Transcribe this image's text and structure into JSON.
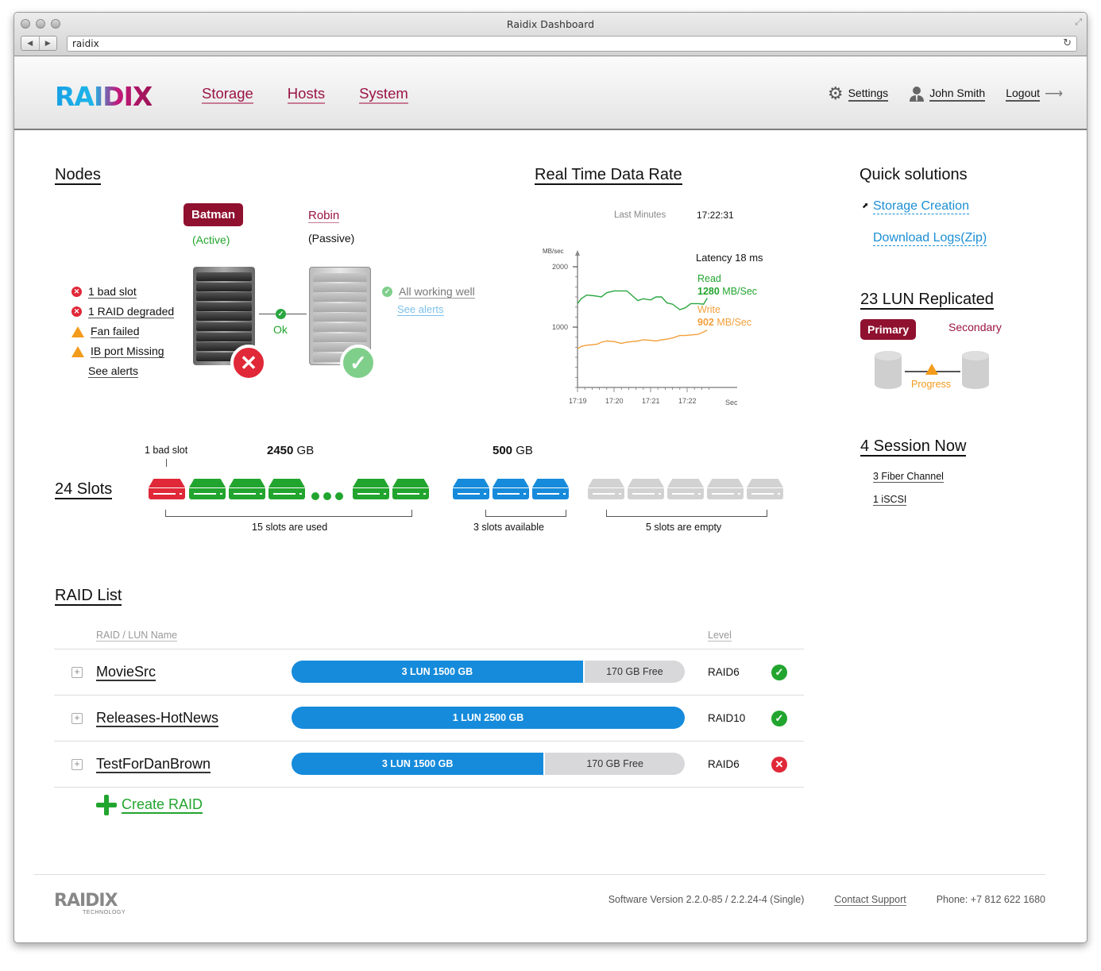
{
  "browser": {
    "window_title": "Raidix Dashboard",
    "url": "raidix",
    "back_icon": "back-arrow-icon",
    "forward_icon": "forward-arrow-icon",
    "reload_icon": "reload-icon"
  },
  "header": {
    "logo": "RAIDIX",
    "nav": [
      "Storage",
      "Hosts",
      "System"
    ],
    "settings_label": "Settings",
    "user_name": "John Smith",
    "logout_label": "Logout"
  },
  "nodes": {
    "title": "Nodes",
    "primary": {
      "name": "Batman",
      "state": "(Active)",
      "status": "error"
    },
    "secondary": {
      "name": "Robin",
      "state": "(Passive)",
      "status": "ok"
    },
    "link_status": "Ok",
    "primary_alerts": [
      {
        "type": "error",
        "text": "1 bad slot"
      },
      {
        "type": "error",
        "text": "1 RAID degraded"
      },
      {
        "type": "warning",
        "text": "Fan failed"
      },
      {
        "type": "warning",
        "text": "IB port Missing"
      }
    ],
    "primary_see_alerts": "See alerts",
    "secondary_alert": "All working well",
    "secondary_see_alerts": "See alerts"
  },
  "realtime": {
    "title": "Real Time Data Rate",
    "subtitle": "Last Minutes",
    "time": "17:22:31",
    "latency": "Latency 18 ms",
    "read_label": "Read",
    "read_value": "1280",
    "read_unit": "MB/Sec",
    "write_label": "Write",
    "write_value": "902",
    "write_unit": "MB/Sec"
  },
  "chart_data": {
    "type": "line",
    "title": "Real Time Data Rate",
    "ylabel": "MB/sec",
    "xlabel": "Second",
    "ylim": [
      0,
      2000
    ],
    "yticks": [
      1000,
      2000
    ],
    "xticks": [
      "17:19",
      "17:20",
      "17:21",
      "17:22"
    ],
    "x": [
      0,
      0.1,
      0.25,
      0.45,
      0.55,
      0.65,
      0.8,
      1.0,
      1.2,
      1.35,
      1.5,
      1.65,
      1.8,
      2.0,
      2.15,
      2.3,
      2.45,
      2.6,
      2.8,
      2.95,
      3.1,
      3.3,
      3.45,
      3.55
    ],
    "series": [
      {
        "name": "Read",
        "color": "#2aa640",
        "values": [
          1390,
          1470,
          1530,
          1520,
          1510,
          1500,
          1570,
          1600,
          1600,
          1600,
          1520,
          1440,
          1470,
          1450,
          1500,
          1500,
          1400,
          1380,
          1290,
          1320,
          1390,
          1390,
          1380,
          1480
        ]
      },
      {
        "name": "Write",
        "color": "#f2a03c",
        "values": [
          640,
          680,
          700,
          710,
          720,
          750,
          770,
          760,
          730,
          750,
          760,
          770,
          790,
          780,
          770,
          790,
          800,
          820,
          860,
          860,
          870,
          880,
          920,
          950
        ]
      }
    ]
  },
  "quick_solutions": {
    "title": "Quick solutions",
    "links": [
      "Storage Creation",
      "Download Logs(Zip)"
    ]
  },
  "replication": {
    "title": "23 LUN Replicated",
    "primary": "Primary",
    "secondary": "Secondary",
    "status": "Progress"
  },
  "sessions": {
    "title": "4 Session Now",
    "items": [
      "3 Fiber Channel",
      "1 iSCSI"
    ]
  },
  "slots": {
    "title": "24 Slots",
    "bad_label": "1 bad slot",
    "used_capacity_value": "2450",
    "used_capacity_unit": "GB",
    "available_capacity_value": "500",
    "available_capacity_unit": "GB",
    "used_label": "15 slots are used",
    "available_label": "3 slots available",
    "empty_label": "5 slots are empty",
    "colors": {
      "bad": "#e02838",
      "used": "#22a52e",
      "available": "#168bdb",
      "empty": "#d2d2d2"
    }
  },
  "raid_list": {
    "title": "RAID List",
    "columns": {
      "name": "RAID / LUN Name",
      "level": "Level"
    },
    "rows": [
      {
        "name": "MovieSrc",
        "usage": "3 LUN  1500 GB",
        "free": "170 GB Free",
        "used_fraction": 0.745,
        "level": "RAID6",
        "status": "ok"
      },
      {
        "name": "Releases-HotNews",
        "usage": "1 LUN  2500 GB",
        "free": "",
        "used_fraction": 1.0,
        "level": "RAID10",
        "status": "ok"
      },
      {
        "name": "TestForDanBrown",
        "usage": "3 LUN  1500 GB",
        "free": "170 GB Free",
        "used_fraction": 0.645,
        "level": "RAID6",
        "status": "error"
      }
    ],
    "create_label": "Create RAID"
  },
  "footer": {
    "logo": "RAIDIX",
    "logo_sub": "TECHNOLOGY",
    "version": "Software Version 2.2.0-85 / 2.2.24-4 (Single)",
    "contact": "Contact Support",
    "phone": "Phone: +7 812 622 1680"
  }
}
